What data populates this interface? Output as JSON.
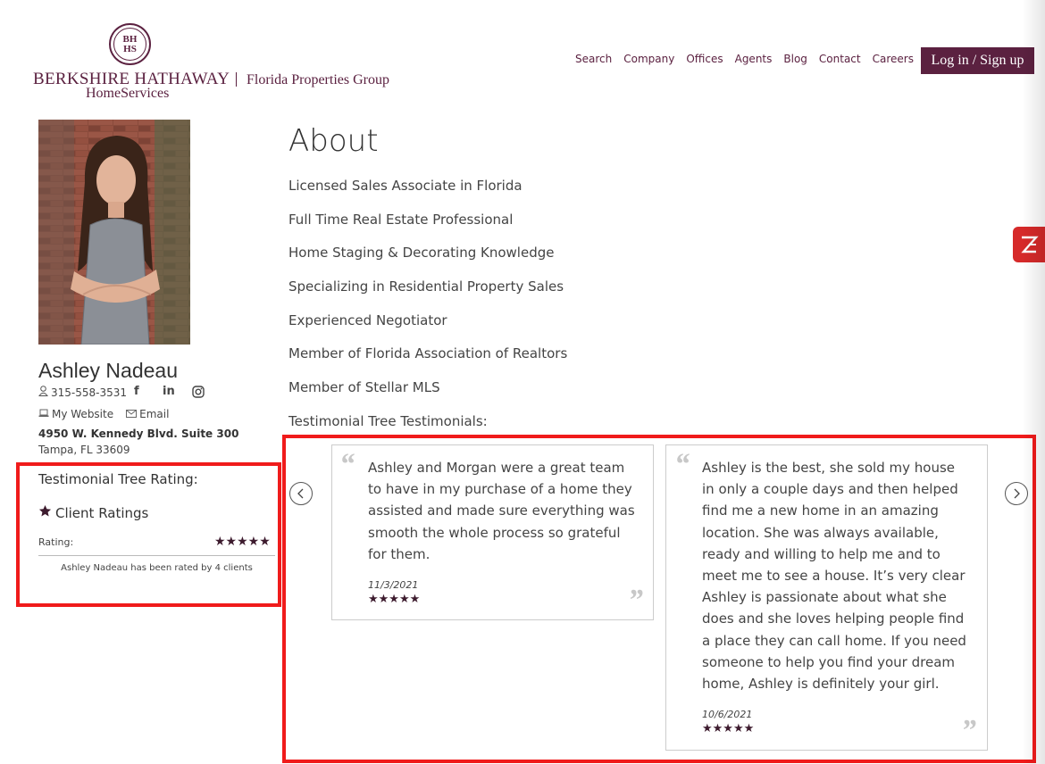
{
  "brand": {
    "seal_line1": "BH",
    "seal_line2": "HS",
    "name": "BERKSHIRE HATHAWAY",
    "group": "Florida Properties Group",
    "home_services": "HomeServices",
    "color": "#5b2140"
  },
  "nav": {
    "items": [
      "Search",
      "Company",
      "Offices",
      "Agents",
      "Blog",
      "Contact",
      "Careers"
    ],
    "login_label": "Log in / Sign up"
  },
  "agent": {
    "name": "Ashley Nadeau",
    "phone": "315-558-3531",
    "social": [
      "f",
      "in",
      "instagram"
    ],
    "website_label": "My Website",
    "email_label": "Email",
    "address_line1": "4950 W. Kennedy Blvd. Suite 300",
    "address_line2": "Tampa, FL 33609"
  },
  "rating": {
    "title": "Testimonial Tree Rating:",
    "client_ratings_label": "Client Ratings",
    "rating_label": "Rating:",
    "stars": 5,
    "rated_by": "Ashley Nadeau has been rated by 4 clients"
  },
  "about": {
    "title": "About",
    "items": [
      "Licensed Sales Associate in Florida",
      "Full Time Real Estate Professional",
      "Home Staging & Decorating Knowledge",
      "Specializing in Residential Property Sales",
      "Experienced Negotiator",
      "Member of Florida Association of Realtors",
      "Member of Stellar MLS",
      "Testimonial Tree Testimonials:"
    ]
  },
  "testimonials": [
    {
      "text": "Ashley and Morgan were a great team to have in my purchase of a home they assisted and made sure everything was smooth the whole process so grateful for them.",
      "date": "11/3/2021",
      "stars": 5
    },
    {
      "text": "Ashley is the best, she sold my house in only a couple days and then helped find me a new home in an amazing location. She was always available, ready and willing to help me and to meet me to see a house. It’s very clear Ashley is passionate about what she does and she loves helping people find a place they can call home. If you need someone to help you find your dream home, Ashley is definitely your girl.",
      "date": "10/6/2021",
      "stars": 5
    }
  ],
  "colors": {
    "accent": "#5b2140",
    "highlight_border": "#f01b1b",
    "star": "#3d1b2e"
  }
}
